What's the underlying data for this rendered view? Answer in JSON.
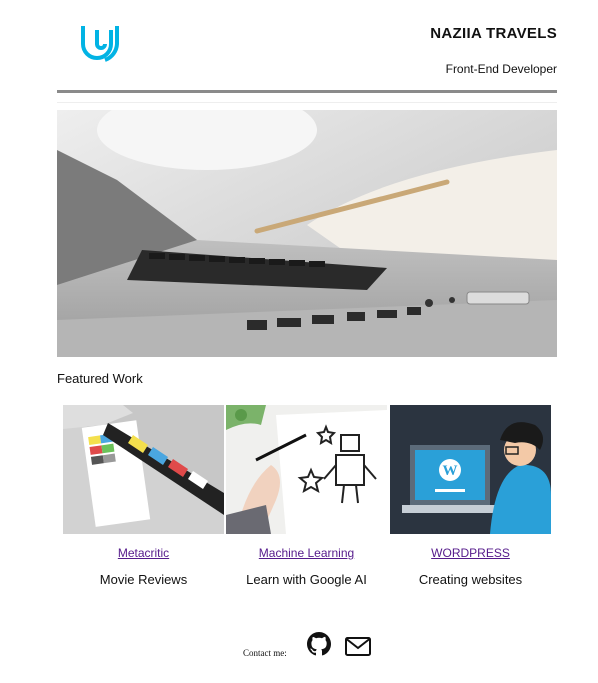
{
  "header": {
    "logo_icon": "udacity-u-logo-icon",
    "brand_color": "#02b3e4",
    "title": "NAZIIA TRAVELS",
    "subtitle": "Front-End Developer"
  },
  "hero": {
    "image": "laptop-and-notebook-photo"
  },
  "featured": {
    "heading": "Featured Work"
  },
  "projects": [
    {
      "image": "film-clapperboard-photo",
      "link": "Metacritic",
      "description": "Movie Reviews"
    },
    {
      "image": "hand-drawing-robot-photo",
      "link": "Machine Learning",
      "description": "Learn with Google AI"
    },
    {
      "image": "wordpress-developer-illustration",
      "link": "WORDPRESS",
      "description": "Creating websites"
    }
  ],
  "contact": {
    "label": "Contact me:",
    "icons": [
      "github-icon",
      "mail-icon"
    ]
  }
}
